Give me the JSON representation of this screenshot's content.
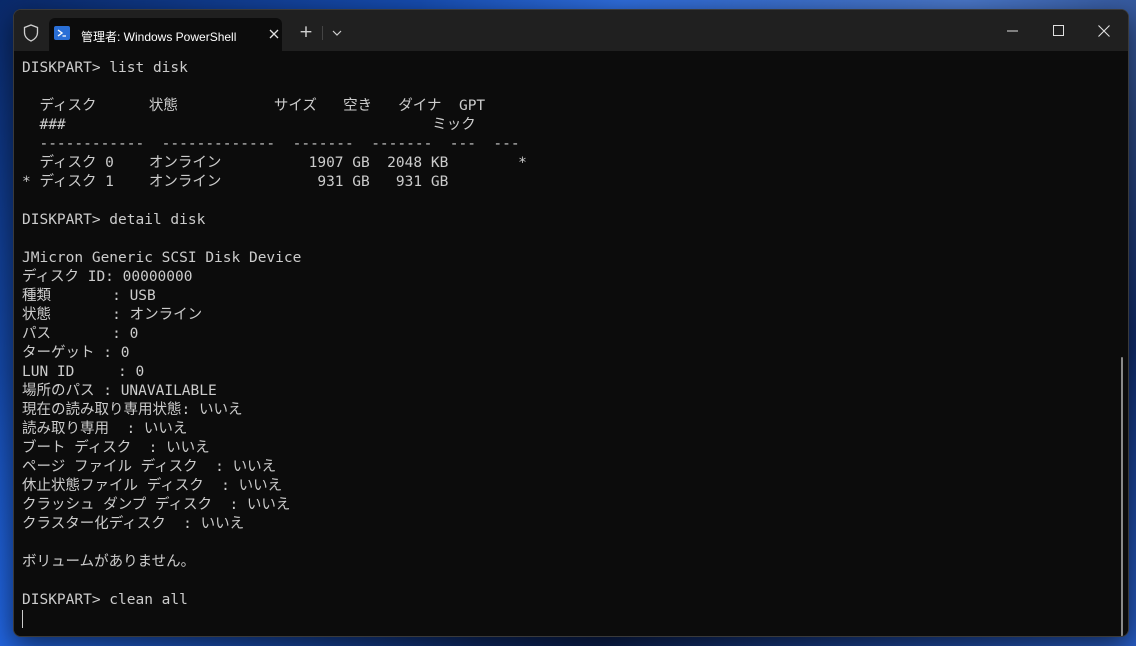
{
  "window": {
    "tab_title": "管理者: Windows PowerShell",
    "new_tab_label": "+"
  },
  "icons": {
    "shield": "shield-icon",
    "powershell": "powershell-icon",
    "close_tab": "close-icon",
    "new_tab": "plus-icon",
    "dropdown": "chevron-down-icon",
    "minimize": "minimize-icon",
    "maximize": "maximize-icon",
    "close_window": "close-icon"
  },
  "colors": {
    "terminal_bg": "#0c0c0c",
    "terminal_fg": "#cccccc",
    "titlebar_bg": "#202020"
  },
  "terminal": {
    "lines": [
      "DISKPART> list disk",
      "",
      "  ディスク      状態           サイズ   空き   ダイナ  GPT",
      "  ###                                          ミック",
      "  ------------  -------------  -------  -------  ---  ---",
      "  ディスク 0    オンライン          1907 GB  2048 KB        *",
      "* ディスク 1    オンライン           931 GB   931 GB",
      "",
      "DISKPART> detail disk",
      "",
      "JMicron Generic SCSI Disk Device",
      "ディスク ID: 00000000",
      "種類       : USB",
      "状態       : オンライン",
      "パス       : 0",
      "ターゲット : 0",
      "LUN ID     : 0",
      "場所のパス : UNAVAILABLE",
      "現在の読み取り専用状態: いいえ",
      "読み取り専用  : いいえ",
      "ブート ディスク  : いいえ",
      "ページ ファイル ディスク  : いいえ",
      "休止状態ファイル ディスク  : いいえ",
      "クラッシュ ダンプ ディスク  : いいえ",
      "クラスター化ディスク  : いいえ",
      "",
      "ボリュームがありません。",
      "",
      "DISKPART> clean all"
    ]
  }
}
